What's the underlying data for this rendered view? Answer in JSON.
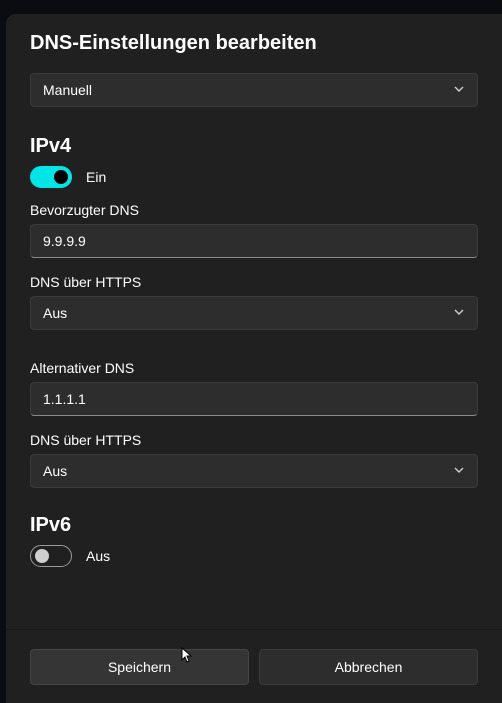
{
  "dialog": {
    "title": "DNS-Einstellungen bearbeiten",
    "mode": {
      "selected": "Manuell"
    }
  },
  "ipv4": {
    "heading": "IPv4",
    "toggle_state": "Ein",
    "preferred_dns_label": "Bevorzugter DNS",
    "preferred_dns_value": "9.9.9.9",
    "doh_label_1": "DNS über HTTPS",
    "doh_value_1": "Aus",
    "alternate_dns_label": "Alternativer DNS",
    "alternate_dns_value": "1.1.1.1",
    "doh_label_2": "DNS über HTTPS",
    "doh_value_2": "Aus"
  },
  "ipv6": {
    "heading": "IPv6",
    "toggle_state": "Aus"
  },
  "footer": {
    "save": "Speichern",
    "cancel": "Abbrechen"
  }
}
